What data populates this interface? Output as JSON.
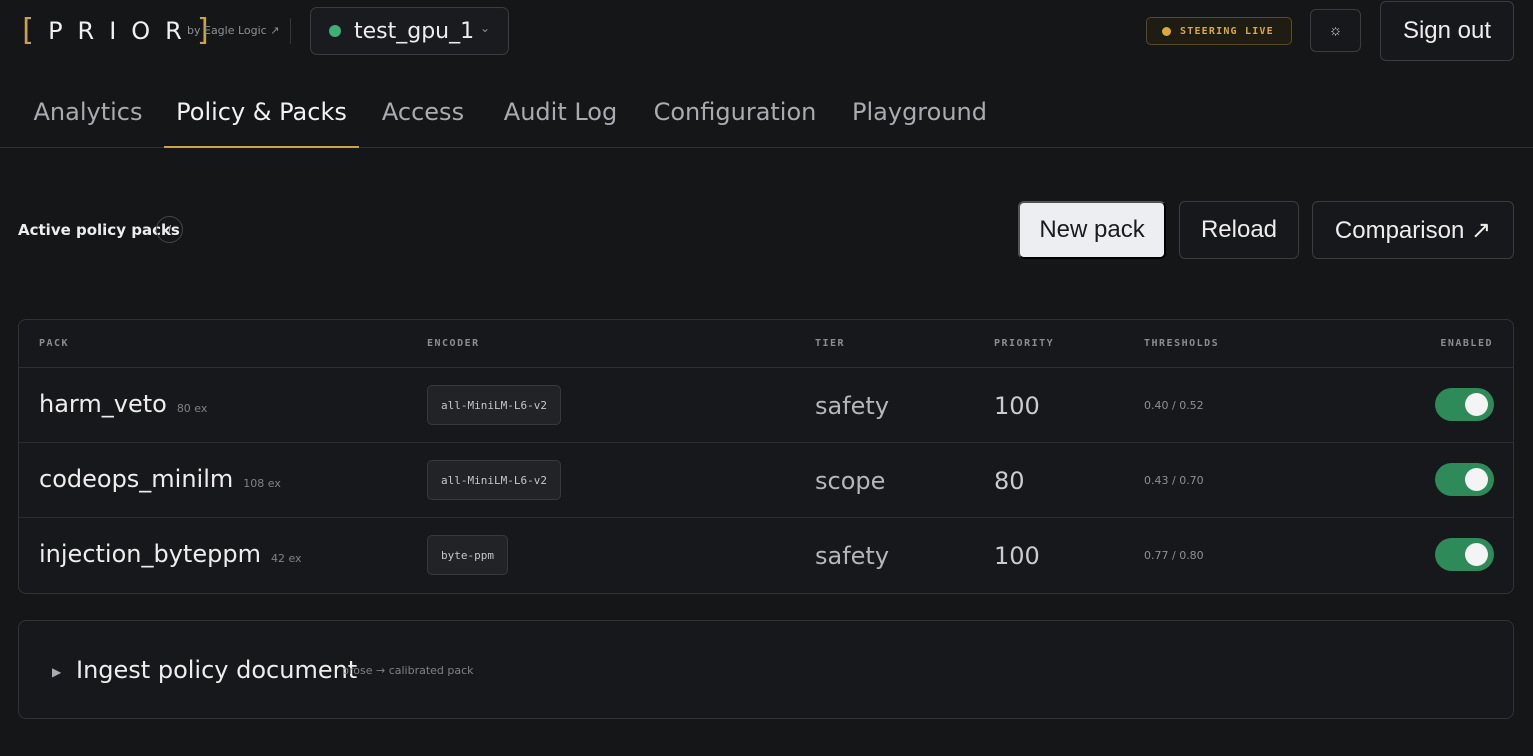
{
  "brand": {
    "bracket_left": "[",
    "wordmark": "PRIOR",
    "bracket_right": "]",
    "byline": "by Eagle Logic ↗",
    "accent_color": "#c9a24d"
  },
  "instance": {
    "name": "test_gpu_1",
    "status_color": "#3fae78",
    "chevron": "⌄"
  },
  "status_badge": {
    "label": "STEERING LIVE",
    "color": "#d9a93e"
  },
  "header": {
    "theme_icon": "sun-icon",
    "theme_glyph": "☼",
    "sign_out_label": "Sign out"
  },
  "tabs": [
    {
      "label": "Analytics",
      "active": false
    },
    {
      "label": "Policy & Packs",
      "active": true
    },
    {
      "label": "Access",
      "active": false
    },
    {
      "label": "Audit Log",
      "active": false
    },
    {
      "label": "Configuration",
      "active": false
    },
    {
      "label": "Playground",
      "active": false
    }
  ],
  "section": {
    "title": "Active policy packs",
    "info_glyph": "i",
    "buttons": {
      "new_pack": "New pack",
      "reload": "Reload",
      "comparison": "Comparison ↗"
    }
  },
  "table": {
    "columns": [
      "PACK",
      "ENCODER",
      "TIER",
      "PRIORITY",
      "THRESHOLDS",
      "ENABLED"
    ],
    "rows": [
      {
        "pack": "harm_veto",
        "examples": "80 ex",
        "encoder": "all-MiniLM-L6-v2",
        "tier": "safety",
        "priority": "100",
        "thresholds": "0.40 / 0.52",
        "enabled": true
      },
      {
        "pack": "codeops_minilm",
        "examples": "108 ex",
        "encoder": "all-MiniLM-L6-v2",
        "tier": "scope",
        "priority": "80",
        "thresholds": "0.43 / 0.70",
        "enabled": true
      },
      {
        "pack": "injection_byteppm",
        "examples": "42 ex",
        "encoder": "byte-ppm",
        "tier": "safety",
        "priority": "100",
        "thresholds": "0.77 / 0.80",
        "enabled": true
      }
    ],
    "toggle_on_color": "#2e8a58"
  },
  "ingest": {
    "caret": "▶",
    "title": "Ingest policy document",
    "subtitle": "prose → calibrated pack"
  }
}
